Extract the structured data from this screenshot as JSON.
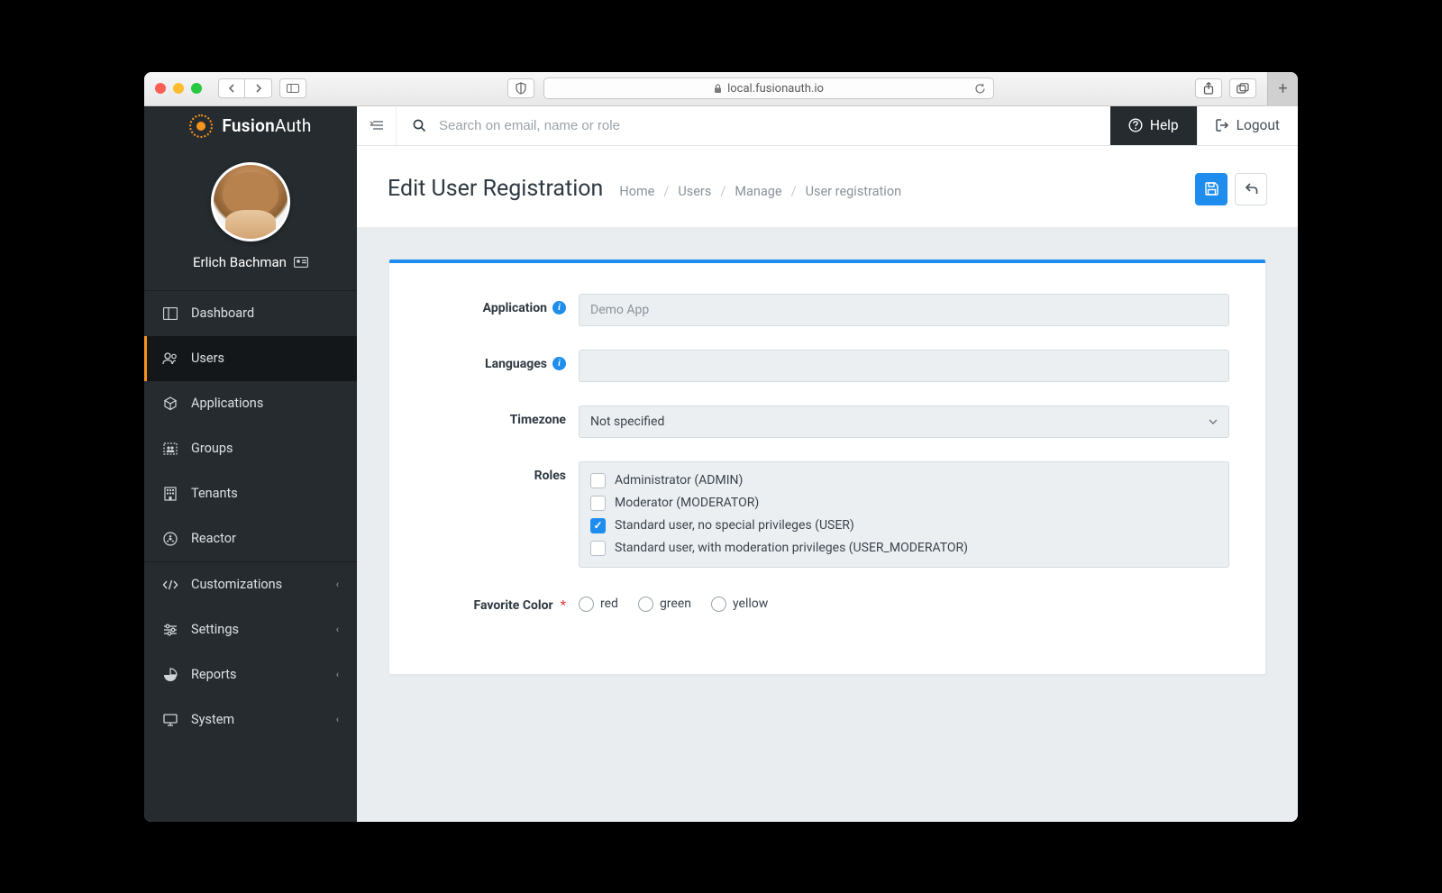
{
  "browser": {
    "url": "local.fusionauth.io"
  },
  "brand": {
    "name_a": "Fusion",
    "name_b": "Auth"
  },
  "user": {
    "display_name": "Erlich Bachman"
  },
  "sidebar": {
    "items": [
      {
        "label": "Dashboard"
      },
      {
        "label": "Users"
      },
      {
        "label": "Applications"
      },
      {
        "label": "Groups"
      },
      {
        "label": "Tenants"
      },
      {
        "label": "Reactor"
      },
      {
        "label": "Customizations"
      },
      {
        "label": "Settings"
      },
      {
        "label": "Reports"
      },
      {
        "label": "System"
      }
    ]
  },
  "topbar": {
    "search_placeholder": "Search on email, name or role",
    "help_label": "Help",
    "logout_label": "Logout"
  },
  "page": {
    "title": "Edit User Registration",
    "breadcrumb": [
      "Home",
      "Users",
      "Manage",
      "User registration"
    ]
  },
  "form": {
    "application": {
      "label": "Application",
      "value": "Demo App"
    },
    "languages": {
      "label": "Languages",
      "value": ""
    },
    "timezone": {
      "label": "Timezone",
      "value": "Not specified"
    },
    "roles": {
      "label": "Roles",
      "options": [
        {
          "label": "Administrator (ADMIN)",
          "checked": false
        },
        {
          "label": "Moderator (MODERATOR)",
          "checked": false
        },
        {
          "label": "Standard user, no special privileges (USER)",
          "checked": true
        },
        {
          "label": "Standard user, with moderation privileges (USER_MODERATOR)",
          "checked": false
        }
      ]
    },
    "favorite_color": {
      "label": "Favorite Color",
      "options": [
        {
          "label": "red"
        },
        {
          "label": "green"
        },
        {
          "label": "yellow"
        }
      ]
    }
  }
}
